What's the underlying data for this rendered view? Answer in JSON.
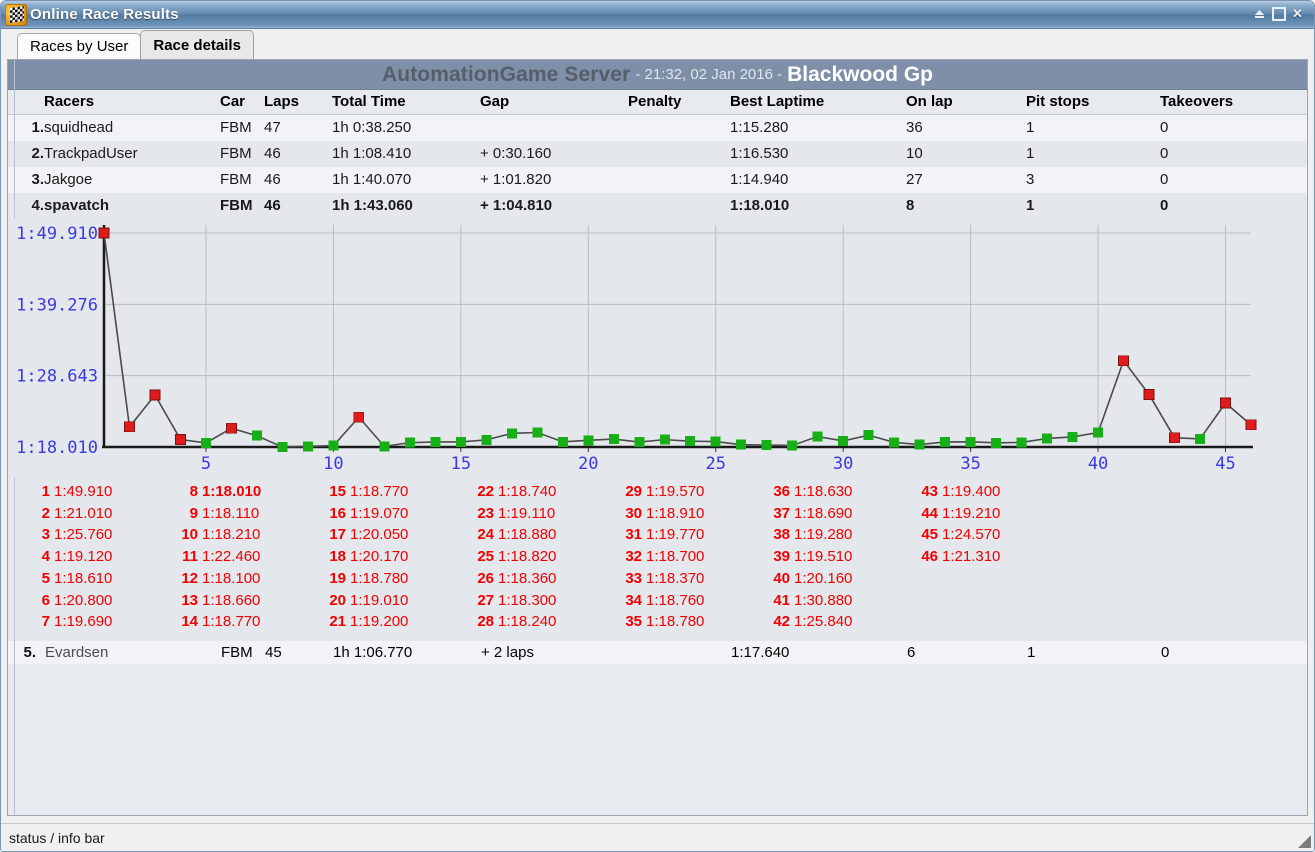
{
  "window": {
    "title": "Online Race Results",
    "icon": "checkered-flag-globe-icon",
    "controls": {
      "minimize": "collapse",
      "maximize": "maximize",
      "close": "✕"
    }
  },
  "tabs": [
    {
      "label": "Races by User",
      "active": false
    },
    {
      "label": "Race details",
      "active": true
    }
  ],
  "header": {
    "server": "AutomationGame Server",
    "meta": " - 21:32, 02 Jan 2016 - ",
    "track": "Blackwood Gp"
  },
  "table": {
    "columns": [
      "Racers",
      "Car",
      "Laps",
      "Total Time",
      "Gap",
      "Penalty",
      "Best Laptime",
      "On lap",
      "Pit stops",
      "Takeovers"
    ],
    "rows": [
      {
        "pos": "1.",
        "racer": "squidhead",
        "car": "FBM",
        "laps": "47",
        "total": "1h 0:38.250",
        "gap": "",
        "penalty": "",
        "best": "1:15.280",
        "onlap": "36",
        "pit": "1",
        "takeovers": "0",
        "selected": false
      },
      {
        "pos": "2.",
        "racer": "TrackpadUser",
        "car": "FBM",
        "laps": "46",
        "total": "1h 1:08.410",
        "gap": "+ 0:30.160",
        "penalty": "",
        "best": "1:16.530",
        "onlap": "10",
        "pit": "1",
        "takeovers": "0",
        "selected": false
      },
      {
        "pos": "3.",
        "racer": "Jakgoe",
        "car": "FBM",
        "laps": "46",
        "total": "1h 1:40.070",
        "gap": "+ 1:01.820",
        "penalty": "",
        "best": "1:14.940",
        "onlap": "27",
        "pit": "3",
        "takeovers": "0",
        "selected": false
      },
      {
        "pos": "4.",
        "racer": "spavatch",
        "car": "FBM",
        "laps": "46",
        "total": "1h 1:43.060",
        "gap": "+ 1:04.810",
        "penalty": "",
        "best": "1:18.010",
        "onlap": "8",
        "pit": "1",
        "takeovers": "0",
        "selected": true
      }
    ],
    "footer_row": {
      "pos": "5.",
      "racer": "Evardsen",
      "car": "FBM",
      "laps": "45",
      "total": "1h 1:06.770",
      "gap": "+ 2 laps",
      "penalty": "",
      "best": "1:17.640",
      "onlap": "6",
      "pit": "1",
      "takeovers": "0",
      "selected": false
    },
    "info_icon": "info-icon"
  },
  "chart_data": {
    "type": "line",
    "title": "",
    "xlabel": "",
    "ylabel": "",
    "xticks": [
      5,
      10,
      15,
      20,
      25,
      30,
      35,
      40,
      45
    ],
    "yticks": [
      "1:18.010",
      "1:28.643",
      "1:39.276",
      "1:49.910"
    ],
    "ytick_seconds": [
      78.01,
      88.643,
      99.276,
      109.91
    ],
    "ylim": [
      78.01,
      109.91
    ],
    "xlim": [
      1,
      46
    ],
    "grid": true,
    "legend": null,
    "marker_colors": {
      "slow": "#e01b1b",
      "fast": "#16b016"
    },
    "line_color": "#4a4a4a",
    "axis_label_color": "#3a3ae0",
    "x": [
      1,
      2,
      3,
      4,
      5,
      6,
      7,
      8,
      9,
      10,
      11,
      12,
      13,
      14,
      15,
      16,
      17,
      18,
      19,
      20,
      21,
      22,
      23,
      24,
      25,
      26,
      27,
      28,
      29,
      30,
      31,
      32,
      33,
      34,
      35,
      36,
      37,
      38,
      39,
      40,
      41,
      42,
      43,
      44,
      45,
      46
    ],
    "values": [
      109.91,
      81.01,
      85.76,
      79.12,
      78.61,
      80.8,
      79.69,
      78.01,
      78.11,
      78.21,
      82.46,
      78.1,
      78.66,
      78.77,
      78.77,
      79.07,
      80.05,
      80.17,
      78.78,
      79.01,
      79.2,
      78.74,
      79.11,
      78.88,
      78.82,
      78.36,
      78.3,
      78.24,
      79.57,
      78.91,
      79.77,
      78.7,
      78.37,
      78.76,
      78.78,
      78.63,
      78.69,
      79.28,
      79.51,
      80.16,
      90.88,
      85.84,
      79.4,
      79.21,
      84.57,
      81.31
    ],
    "labels": [
      "1:49.910",
      "1:21.010",
      "1:25.760",
      "1:19.120",
      "1:18.610",
      "1:20.800",
      "1:19.690",
      "1:18.010",
      "1:18.110",
      "1:18.210",
      "1:22.460",
      "1:18.100",
      "1:18.660",
      "1:18.770",
      "1:18.770",
      "1:19.070",
      "1:20.050",
      "1:20.170",
      "1:18.780",
      "1:19.010",
      "1:19.200",
      "1:18.740",
      "1:19.110",
      "1:18.880",
      "1:18.820",
      "1:18.360",
      "1:18.300",
      "1:18.240",
      "1:19.570",
      "1:18.910",
      "1:19.770",
      "1:18.700",
      "1:18.370",
      "1:18.760",
      "1:18.780",
      "1:18.630",
      "1:18.690",
      "1:19.280",
      "1:19.510",
      "1:20.160",
      "1:30.880",
      "1:25.840",
      "1:19.400",
      "1:19.210",
      "1:24.570",
      "1:21.310"
    ],
    "point_kinds": [
      "slow",
      "slow",
      "slow",
      "slow",
      "fast",
      "slow",
      "fast",
      "fast",
      "fast",
      "fast",
      "slow",
      "fast",
      "fast",
      "fast",
      "fast",
      "fast",
      "fast",
      "fast",
      "fast",
      "fast",
      "fast",
      "fast",
      "fast",
      "fast",
      "fast",
      "fast",
      "fast",
      "fast",
      "fast",
      "fast",
      "fast",
      "fast",
      "fast",
      "fast",
      "fast",
      "fast",
      "fast",
      "fast",
      "fast",
      "fast",
      "slow",
      "slow",
      "slow",
      "fast",
      "slow",
      "slow"
    ]
  },
  "lap_columns": [
    [
      {
        "no": "1",
        "time": "1:49.910",
        "best": false
      },
      {
        "no": "2",
        "time": "1:21.010",
        "best": false
      },
      {
        "no": "3",
        "time": "1:25.760",
        "best": false
      },
      {
        "no": "4",
        "time": "1:19.120",
        "best": false
      },
      {
        "no": "5",
        "time": "1:18.610",
        "best": false
      },
      {
        "no": "6",
        "time": "1:20.800",
        "best": false
      },
      {
        "no": "7",
        "time": "1:19.690",
        "best": false
      }
    ],
    [
      {
        "no": "8",
        "time": "1:18.010",
        "best": true
      },
      {
        "no": "9",
        "time": "1:18.110",
        "best": false
      },
      {
        "no": "10",
        "time": "1:18.210",
        "best": false
      },
      {
        "no": "11",
        "time": "1:22.460",
        "best": false
      },
      {
        "no": "12",
        "time": "1:18.100",
        "best": false
      },
      {
        "no": "13",
        "time": "1:18.660",
        "best": false
      },
      {
        "no": "14",
        "time": "1:18.770",
        "best": false
      }
    ],
    [
      {
        "no": "15",
        "time": "1:18.770",
        "best": false
      },
      {
        "no": "16",
        "time": "1:19.070",
        "best": false
      },
      {
        "no": "17",
        "time": "1:20.050",
        "best": false
      },
      {
        "no": "18",
        "time": "1:20.170",
        "best": false
      },
      {
        "no": "19",
        "time": "1:18.780",
        "best": false
      },
      {
        "no": "20",
        "time": "1:19.010",
        "best": false
      },
      {
        "no": "21",
        "time": "1:19.200",
        "best": false
      }
    ],
    [
      {
        "no": "22",
        "time": "1:18.740",
        "best": false
      },
      {
        "no": "23",
        "time": "1:19.110",
        "best": false
      },
      {
        "no": "24",
        "time": "1:18.880",
        "best": false
      },
      {
        "no": "25",
        "time": "1:18.820",
        "best": false
      },
      {
        "no": "26",
        "time": "1:18.360",
        "best": false
      },
      {
        "no": "27",
        "time": "1:18.300",
        "best": false
      },
      {
        "no": "28",
        "time": "1:18.240",
        "best": false
      }
    ],
    [
      {
        "no": "29",
        "time": "1:19.570",
        "best": false
      },
      {
        "no": "30",
        "time": "1:18.910",
        "best": false
      },
      {
        "no": "31",
        "time": "1:19.770",
        "best": false
      },
      {
        "no": "32",
        "time": "1:18.700",
        "best": false
      },
      {
        "no": "33",
        "time": "1:18.370",
        "best": false
      },
      {
        "no": "34",
        "time": "1:18.760",
        "best": false
      },
      {
        "no": "35",
        "time": "1:18.780",
        "best": false
      }
    ],
    [
      {
        "no": "36",
        "time": "1:18.630",
        "best": false
      },
      {
        "no": "37",
        "time": "1:18.690",
        "best": false
      },
      {
        "no": "38",
        "time": "1:19.280",
        "best": false
      },
      {
        "no": "39",
        "time": "1:19.510",
        "best": false
      },
      {
        "no": "40",
        "time": "1:20.160",
        "best": false
      },
      {
        "no": "41",
        "time": "1:30.880",
        "best": false
      },
      {
        "no": "42",
        "time": "1:25.840",
        "best": false
      }
    ],
    [
      {
        "no": "43",
        "time": "1:19.400",
        "best": false
      },
      {
        "no": "44",
        "time": "1:19.210",
        "best": false
      },
      {
        "no": "45",
        "time": "1:24.570",
        "best": false
      },
      {
        "no": "46",
        "time": "1:21.310",
        "best": false
      }
    ]
  ],
  "statusbar": {
    "text": "status / info bar"
  }
}
